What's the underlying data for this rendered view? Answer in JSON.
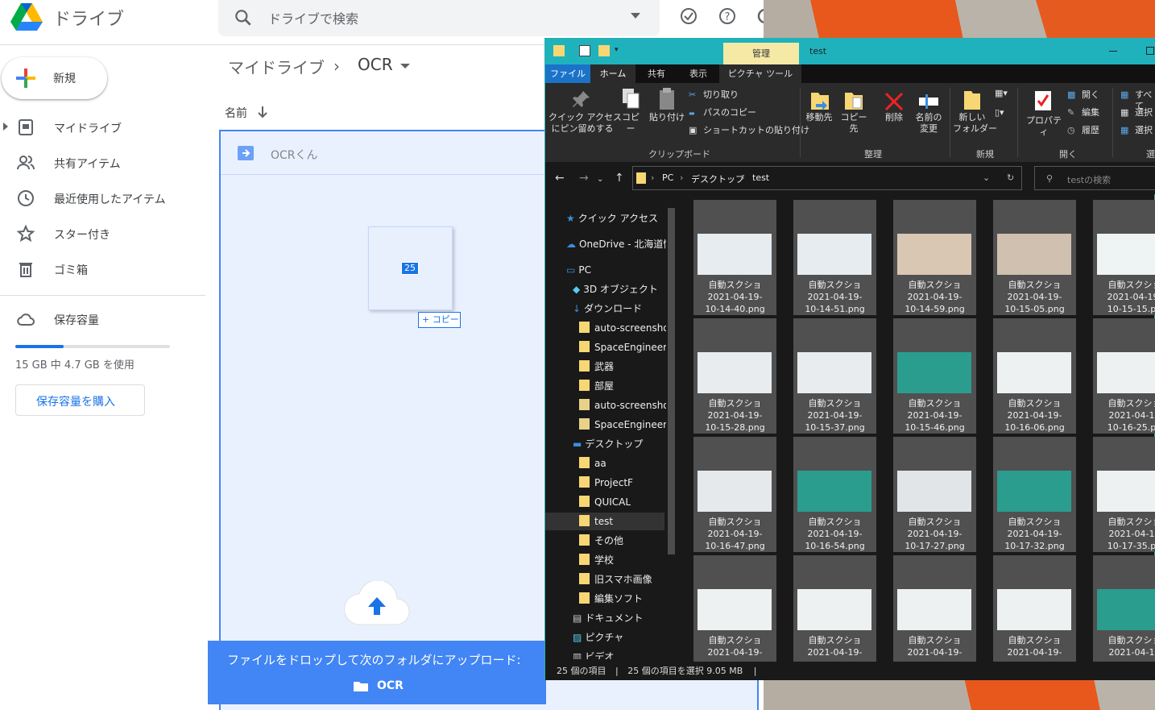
{
  "drive": {
    "brand": "ドライブ",
    "search_placeholder": "ドライブで検索",
    "new_label": "新規",
    "nav": [
      "マイドライブ",
      "共有アイテム",
      "最近使用したアイテム",
      "スター付き",
      "ゴミ箱"
    ],
    "storage_label": "保存容量",
    "storage_used_fraction": 0.31,
    "storage_usage": "15 GB 中 4.7 GB を使用",
    "buy_storage": "保存容量を購入",
    "breadcrumb": [
      "マイドライブ",
      "OCR"
    ],
    "col_name": "名前",
    "row_name": "OCRくん",
    "drag_count": "25",
    "drag_op": "+ コピー",
    "toast_text": "ファイルをドロップして次のフォルダにアップロード:",
    "toast_folder": "OCR"
  },
  "explorer": {
    "mgmt_tab": "管理",
    "title": "test",
    "tabs": [
      "ファイル",
      "ホーム",
      "共有",
      "表示",
      "ピクチャ ツール"
    ],
    "ribbon": {
      "pin": "クイック アクセス\nにピン留めする",
      "copy": "コピー",
      "paste": "貼り付け",
      "cut": "切り取り",
      "copy_path": "パスのコピー",
      "paste_shortcut": "ショートカットの貼り付け",
      "move_to": "移動先",
      "copy_to": "コピー先",
      "delete": "削除",
      "rename": "名前の\n変更",
      "new_folder": "新しい\nフォルダー",
      "properties": "プロパティ",
      "open": "開く",
      "edit": "編集",
      "history": "履歴",
      "select_all": "すべて",
      "select_none": "選択",
      "invert": "選択",
      "grp_clipboard": "クリップボード",
      "grp_organize": "整理",
      "grp_new": "新規",
      "grp_open": "開く",
      "grp_select": "選"
    },
    "path": [
      "PC",
      "デスクトップ",
      "test"
    ],
    "search_placeholder": "testの検索",
    "tree": [
      "クイック アクセス",
      "OneDrive - 北海道情",
      "PC",
      "3D オブジェクト",
      "ダウンロード",
      "auto-screenshot",
      "SpaceEngineersT",
      "武器",
      "部屋",
      "auto-screenshot",
      "SpaceEngineersT",
      "デスクトップ",
      "aa",
      "ProjectF",
      "QUICAL",
      "test",
      "その他",
      "学校",
      "旧スマホ画像",
      "編集ソフト",
      "ドキュメント",
      "ピクチャ",
      "ビデオ"
    ],
    "files": [
      "自動スクショ\n2021-04-19-\n10-14-40.png",
      "自動スクショ\n2021-04-19-\n10-14-51.png",
      "自動スクショ\n2021-04-19-\n10-14-59.png",
      "自動スクショ\n2021-04-19-\n10-15-05.png",
      "自動スクショ\n2021-04-19-\n10-15-15.pn",
      "自動スクショ\n2021-04-19-\n10-15-28.png",
      "自動スクショ\n2021-04-19-\n10-15-37.png",
      "自動スクショ\n2021-04-19-\n10-15-46.png",
      "自動スクショ\n2021-04-19-\n10-16-06.png",
      "自動スクショ\n2021-04-19\n10-16-25.pn",
      "自動スクショ\n2021-04-19-\n10-16-47.png",
      "自動スクショ\n2021-04-19-\n10-16-54.png",
      "自動スクショ\n2021-04-19-\n10-17-27.png",
      "自動スクショ\n2021-04-19-\n10-17-32.png",
      "自動スクショ\n2021-04-19\n10-17-35.pn",
      "自動スクショ\n2021-04-19-",
      "自動スクショ\n2021-04-19-",
      "自動スクショ\n2021-04-19-",
      "自動スクショ\n2021-04-19-",
      "自動スクショ\n2021-04-19"
    ],
    "status_items": "25 個の項目",
    "status_selected": "25 個の項目を選択  9.05 MB"
  },
  "colors": {
    "drive_blue": "#4285f4",
    "explorer_title": "#1fb2bd",
    "manage_tab": "#f5e9a5"
  }
}
